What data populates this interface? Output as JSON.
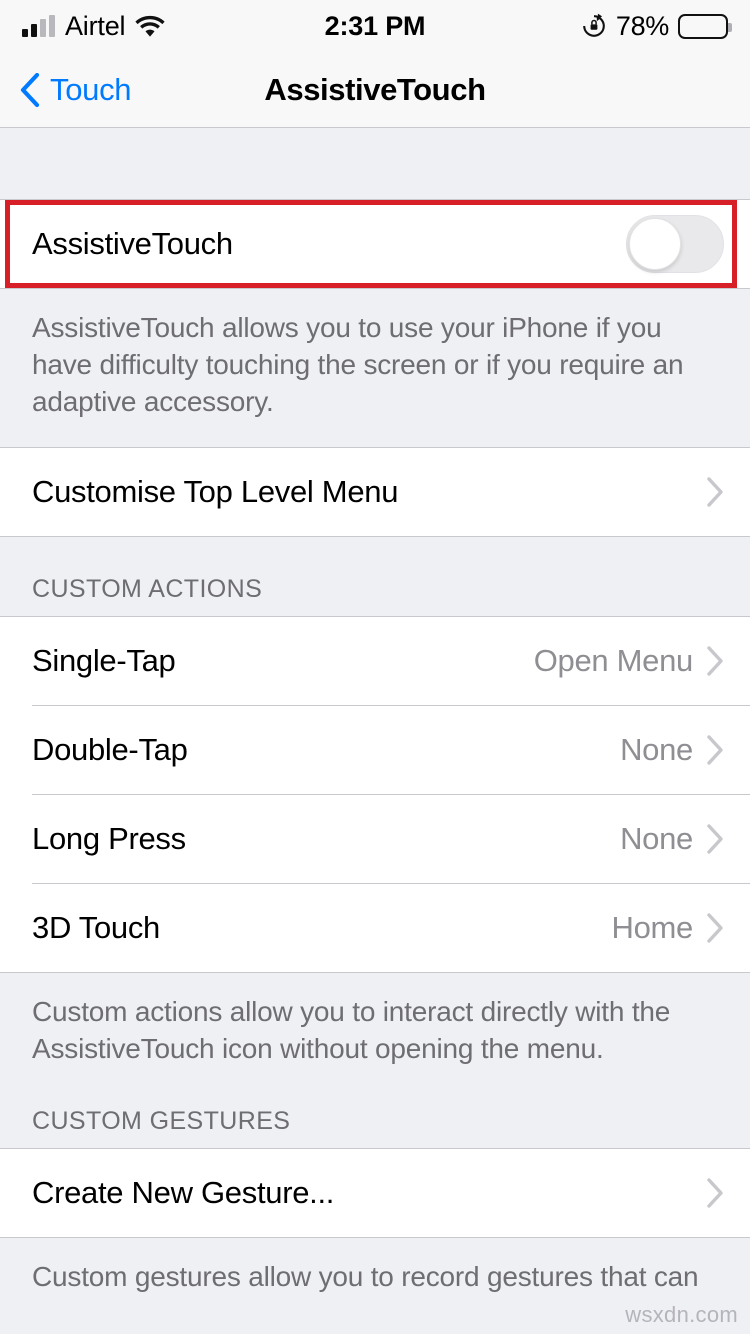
{
  "status_bar": {
    "carrier": "Airtel",
    "time": "2:31 PM",
    "battery_percent": "78%",
    "battery_level": 78,
    "signal_bars_filled": 2,
    "signal_bars_total": 4,
    "wifi_icon": "wifi-icon",
    "rotation_lock_icon": "rotation-lock-icon",
    "battery_icon": "battery-icon"
  },
  "nav": {
    "back_label": "Touch",
    "back_icon": "chevron-left-icon",
    "title": "AssistiveTouch",
    "accent_color": "#007AFF"
  },
  "main": {
    "toggle_row": {
      "label": "AssistiveTouch",
      "state": "off",
      "highlighted": true,
      "highlight_color": "#D61F26"
    },
    "toggle_footer": "AssistiveTouch allows you to use your iPhone if you have difficulty touching the screen or if you require an adaptive accessory.",
    "customise_row": {
      "label": "Customise Top Level Menu",
      "chevron_icon": "chevron-right-icon"
    },
    "custom_actions": {
      "header": "CUSTOM ACTIONS",
      "rows": [
        {
          "label": "Single-Tap",
          "value": "Open Menu",
          "chevron_icon": "chevron-right-icon"
        },
        {
          "label": "Double-Tap",
          "value": "None",
          "chevron_icon": "chevron-right-icon"
        },
        {
          "label": "Long Press",
          "value": "None",
          "chevron_icon": "chevron-right-icon"
        },
        {
          "label": "3D Touch",
          "value": "Home",
          "chevron_icon": "chevron-right-icon"
        }
      ],
      "footer": "Custom actions allow you to interact directly with the AssistiveTouch icon without opening the menu."
    },
    "custom_gestures": {
      "header": "CUSTOM GESTURES",
      "rows": [
        {
          "label": "Create New Gesture...",
          "chevron_icon": "chevron-right-icon"
        }
      ],
      "footer": "Custom gestures allow you to record gestures that can"
    }
  },
  "watermark": "wsxdn.com"
}
